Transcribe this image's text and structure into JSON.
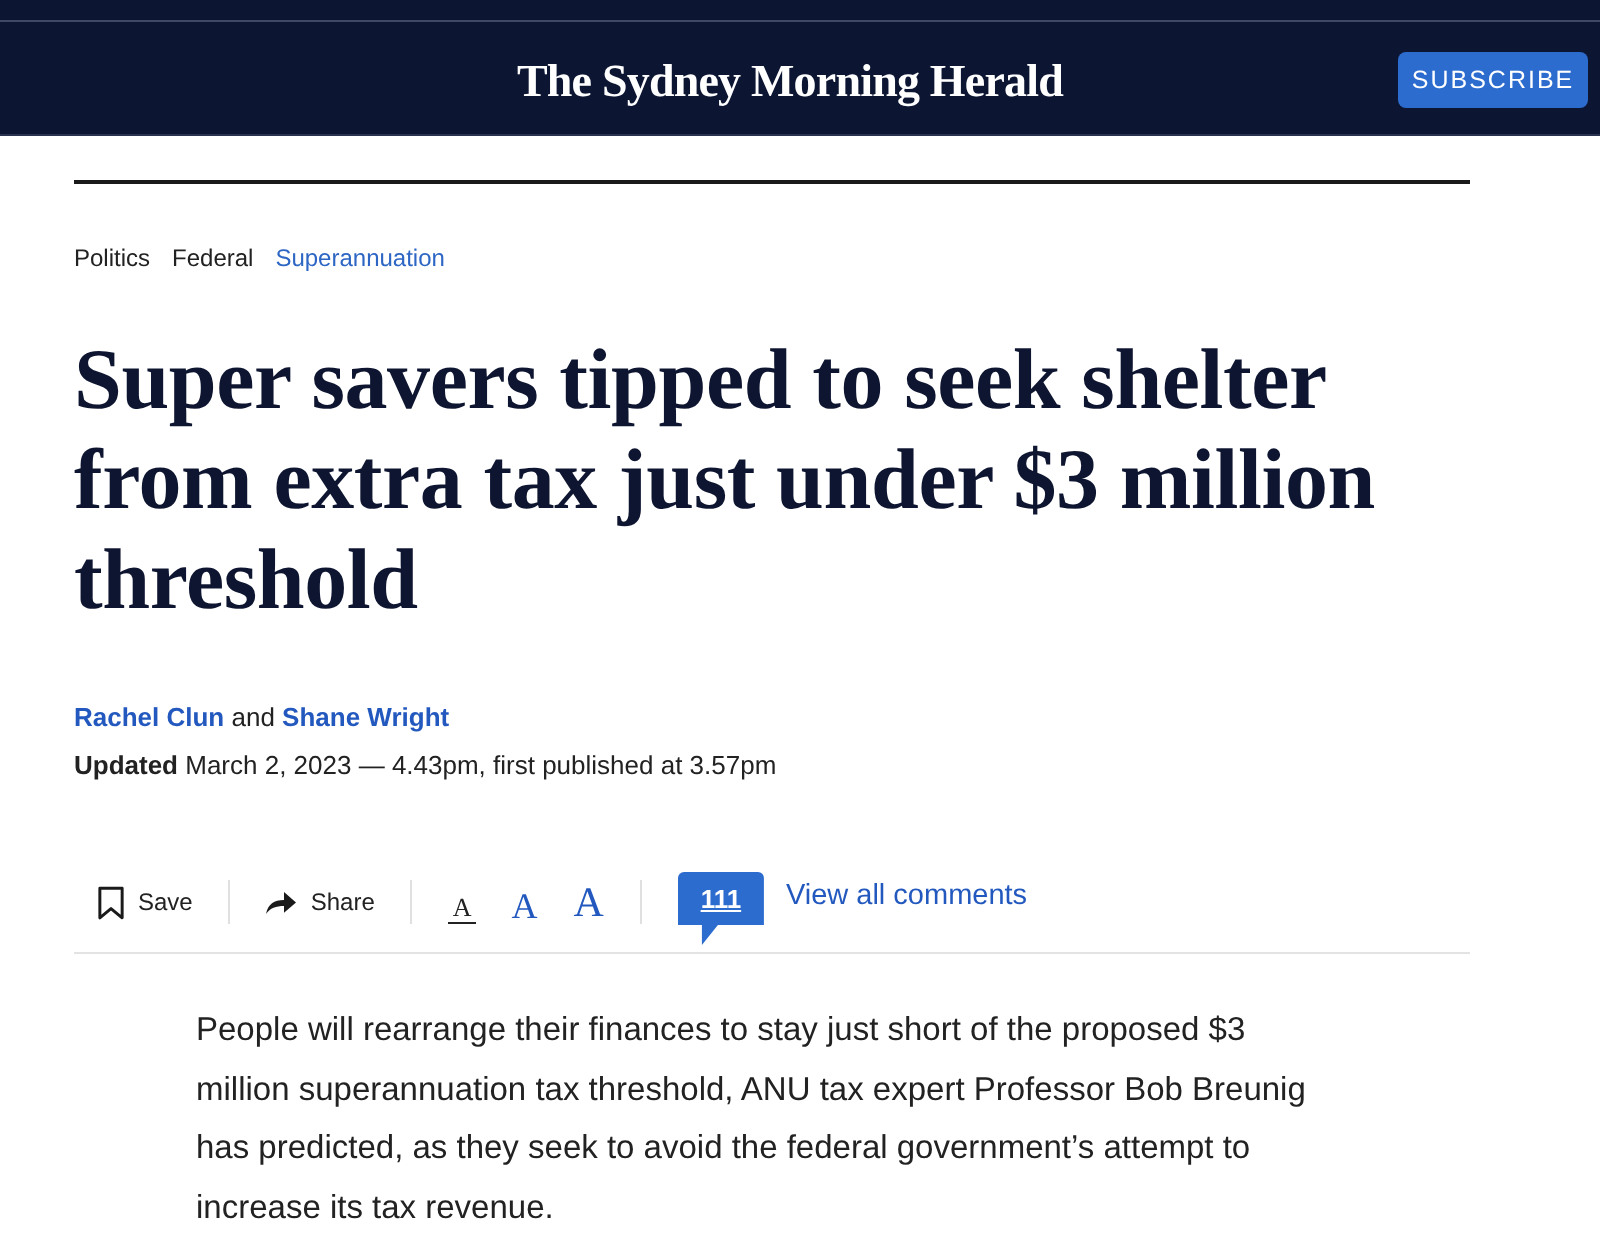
{
  "header": {
    "logo": "The Sydney Morning Herald",
    "subscribe_button": "SUBSCRIBE"
  },
  "breadcrumbs": [
    {
      "label": "Politics",
      "kind": "plain"
    },
    {
      "label": "Federal",
      "kind": "plain"
    },
    {
      "label": "Superannuation",
      "kind": "link"
    }
  ],
  "headline": "Super savers tipped to seek shelter from extra tax just under $3 million threshold",
  "byline": {
    "authors": [
      "Rachel Clun",
      "Shane Wright"
    ],
    "joiner": "and"
  },
  "dateline": "**Updated** March 2, 2023 — 4.43pm, first published at 3.57pm",
  "toolbar": {
    "save": "Save",
    "share": "Share",
    "text_sizes": [
      {
        "label": "A",
        "selected": true
      },
      {
        "label": "A",
        "selected": false
      },
      {
        "label": "A",
        "selected": false
      }
    ],
    "comment_count": "111",
    "comments_link": "View all comments"
  },
  "body": [
    "People will rearrange their finances to stay just short of the proposed $3 million superannuation tax threshold, ANU tax expert Professor Bob Breunig has predicted, as they seek to avoid the federal government’s attempt to increase its tax revenue."
  ]
}
